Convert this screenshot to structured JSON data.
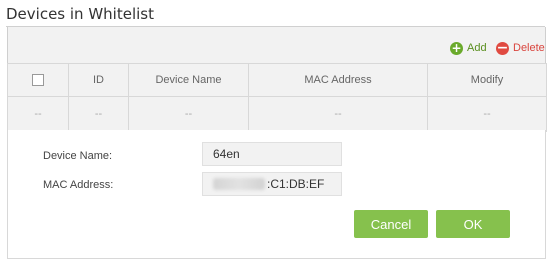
{
  "header": {
    "title": "Devices in Whitelist"
  },
  "toolbar": {
    "add_label": "Add",
    "delete_label": "Delete",
    "add_icon": "plus-circle-icon",
    "delete_icon": "minus-circle-icon"
  },
  "table": {
    "columns": [
      "",
      "ID",
      "Device Name",
      "MAC Address",
      "Modify"
    ],
    "rows": [
      [
        "--",
        "--",
        "--",
        "--",
        "--"
      ]
    ]
  },
  "form": {
    "device_name_label": "Device Name:",
    "device_name_value": "64en",
    "mac_address_label": "MAC Address:",
    "mac_address_value_visible": ":C1:DB:EF"
  },
  "buttons": {
    "cancel_label": "Cancel",
    "ok_label": "OK"
  },
  "colors": {
    "accent_green": "#86c14d",
    "add_green": "#6aaa2b",
    "delete_red": "#e04a41"
  }
}
